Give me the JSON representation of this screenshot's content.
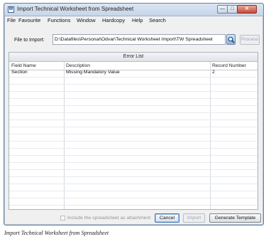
{
  "window": {
    "title": "Import Technical Worksheet from Spreadsheet",
    "icon_glyph": "W",
    "controls": {
      "minimize": "—",
      "maximize": "□",
      "close": "✕"
    }
  },
  "menu": [
    "File",
    "Favourite",
    "Functions",
    "Window",
    "Hardcopy",
    "Help",
    "Search"
  ],
  "file_import": {
    "label": "File to Import:",
    "value": "D:\\Datafiles\\Personal\\Odvar\\Technical Worksheet Import\\TW Spreadsheet",
    "process_label": "Process"
  },
  "error_list": {
    "title": "Error List",
    "columns": [
      "Field Name",
      "Description",
      "Record Number"
    ],
    "rows": [
      {
        "field": "Section",
        "description": "Missing Mandatory Value",
        "record": "2"
      }
    ]
  },
  "footer": {
    "checkbox_label": "Include the spreadsheet as attachment",
    "checkbox_checked": false,
    "cancel_label": "Cancel",
    "import_label": "Import",
    "template_label": "Generate Template"
  },
  "caption": "Import Technical Worksheet from Spreadsheet",
  "colors": {
    "window_bg": "#f0f0f0",
    "titlebar": "#c6d5e8",
    "close_red": "#c84a37",
    "focus_blue": "#3b78c4"
  }
}
